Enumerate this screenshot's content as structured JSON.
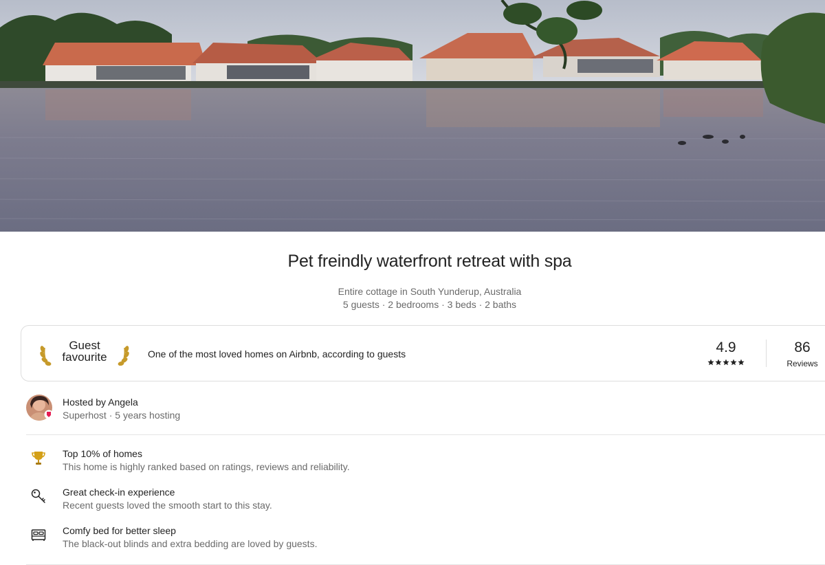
{
  "listing": {
    "title": "Pet freindly waterfront retreat with spa",
    "subtitle_line1": "Entire cottage in South Yunderup, Australia",
    "subtitle_line2": "5 guests · 2 bedrooms · 3 beds · 2 baths"
  },
  "guest_favourite": {
    "badge_label": "Guest favourite",
    "description": "One of the most loved homes on Airbnb, according to guests",
    "rating": "4.9",
    "stars": 5,
    "reviews_count": "86",
    "reviews_label": "Reviews",
    "icons": [
      "laurel-left-icon",
      "laurel-right-icon",
      "star-icon"
    ]
  },
  "host": {
    "name_line": "Hosted by Angela",
    "meta_line": "Superhost · 5 years hosting",
    "avatar_icon": "avatar",
    "badge_icon": "superhost-badge-icon"
  },
  "highlights": [
    {
      "icon": "trophy-icon",
      "title": "Top 10% of homes",
      "text": "This home is highly ranked based on ratings, reviews and reliability."
    },
    {
      "icon": "key-icon",
      "title": "Great check-in experience",
      "text": "Recent guests loved the smooth start to this stay."
    },
    {
      "icon": "bed-icon",
      "title": "Comfy bed for better sleep",
      "text": "The black-out blinds and extra bedding are loved by guests."
    }
  ],
  "colors": {
    "text": "#222222",
    "muted": "#6a6a6a",
    "border": "#dddddd",
    "brand": "#e51d53",
    "trophy": "#d4a017"
  }
}
